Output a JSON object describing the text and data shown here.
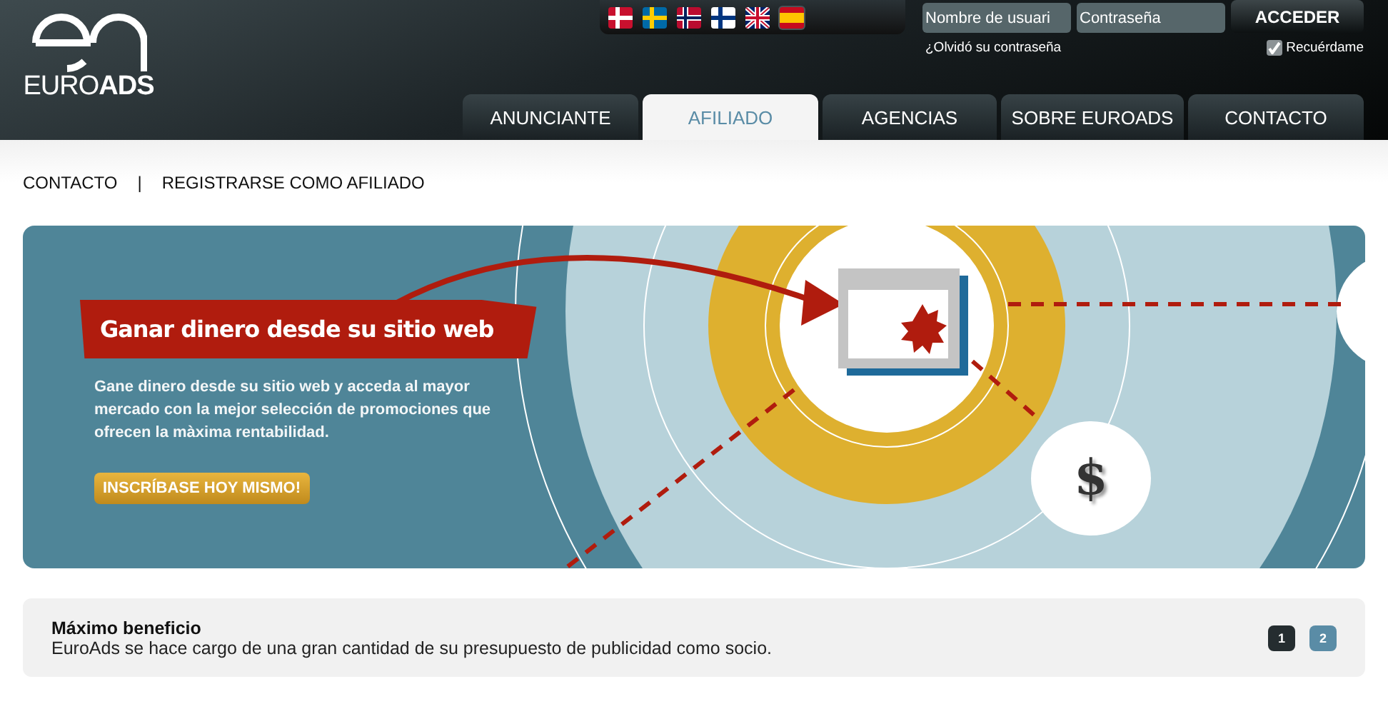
{
  "logo": {
    "word_light": "EURO",
    "word_bold": "ADS"
  },
  "languages": [
    {
      "kind": "dk",
      "selected": false
    },
    {
      "kind": "se",
      "selected": false
    },
    {
      "kind": "no",
      "selected": false
    },
    {
      "kind": "fi",
      "selected": false
    },
    {
      "kind": "gb",
      "selected": false
    },
    {
      "kind": "es",
      "selected": true
    }
  ],
  "login": {
    "username_placeholder": "Nombre de usuari",
    "password_placeholder": "Contraseña",
    "submit": "ACCEDER",
    "forgot": "¿Olvidó su contraseña",
    "remember": {
      "label": "Recuérdame",
      "checked": true
    }
  },
  "nav": [
    {
      "label": "ANUNCIANTE",
      "selected": false
    },
    {
      "label": "AFILIADO",
      "selected": true
    },
    {
      "label": "AGENCIAS",
      "selected": false
    },
    {
      "label": "SOBRE EUROADS",
      "selected": false
    },
    {
      "label": "CONTACTO",
      "selected": false
    }
  ],
  "breadcrumb": {
    "items": [
      "CONTACTO",
      "REGISTRARSE COMO AFILIADO"
    ],
    "separator": "|"
  },
  "banner": {
    "title": "Ganar dinero desde su sitio web",
    "text": "Gane dinero desde su sitio  web y acceda al mayor mercado con la mejor selección de promociones que ofrecen la màxima rentabilidad.",
    "button": "INSCRÍBASE HOY MISMO!",
    "coin": "$"
  },
  "feature": {
    "title": "Máximo beneficio",
    "text": "EuroAds se hace cargo de una gran cantidad de su  presupuesto de publicidad como socio."
  },
  "pages": [
    {
      "label": "1",
      "selected": true
    },
    {
      "label": "2",
      "selected": false
    }
  ]
}
